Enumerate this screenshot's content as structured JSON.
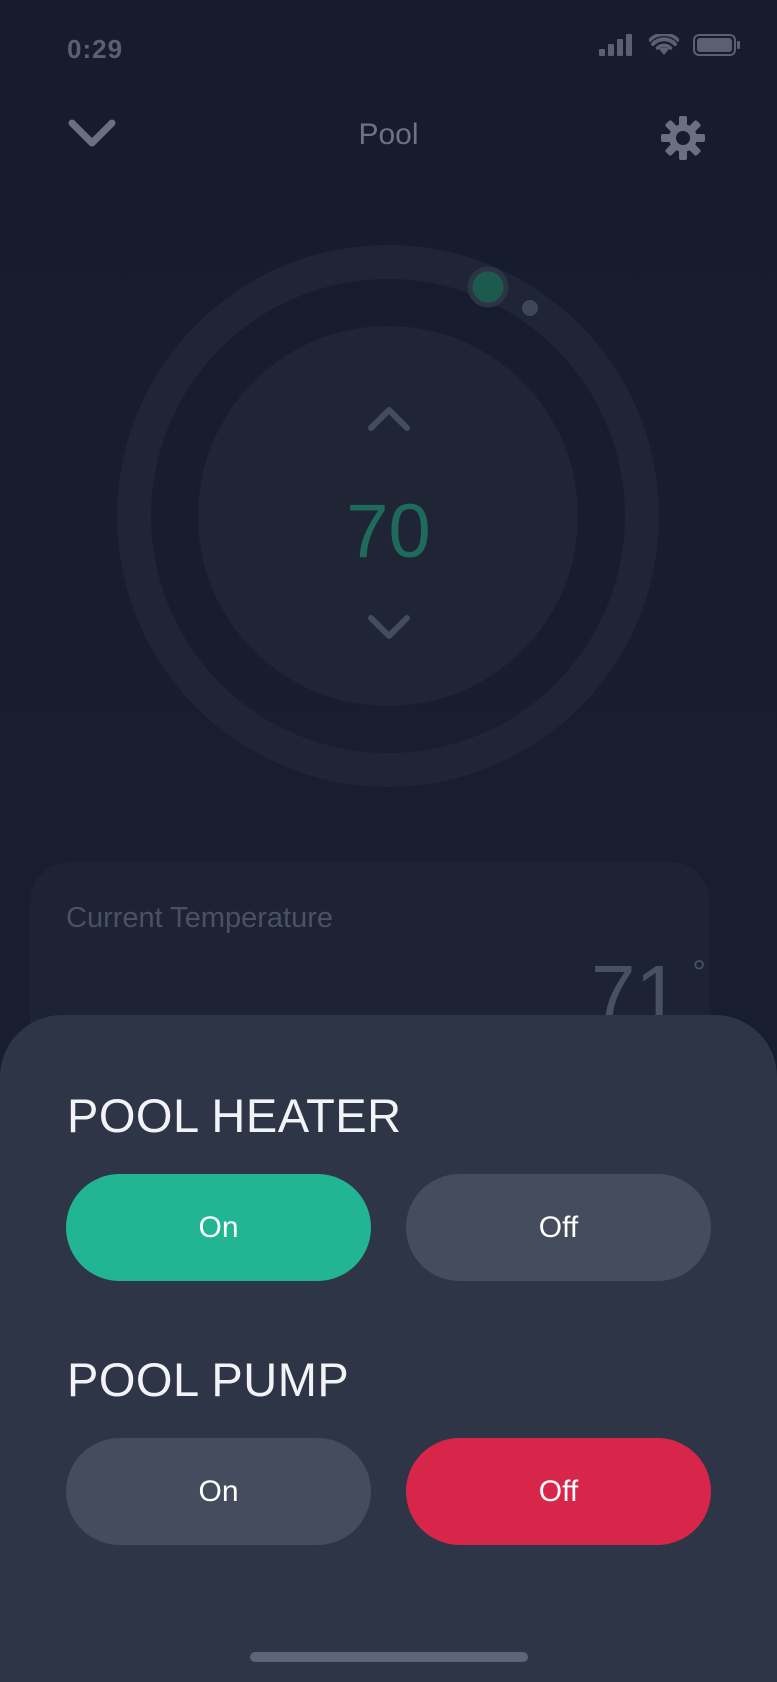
{
  "status_bar": {
    "time": "0:29",
    "icons": [
      "cellular-signal-icon",
      "wifi-icon",
      "battery-icon"
    ]
  },
  "header": {
    "title": "Pool",
    "back_icon": "chevron-down-icon",
    "settings_icon": "gear-icon"
  },
  "dial": {
    "value": "70",
    "up_icon": "chevron-up-icon",
    "down_icon": "chevron-down-icon"
  },
  "current_temperature": {
    "label": "Current Temperature",
    "value": "71",
    "unit": "°"
  },
  "pool_heater": {
    "title": "POOL HEATER",
    "on_label": "On",
    "off_label": "Off",
    "selected": "On"
  },
  "pool_pump": {
    "title": "POOL PUMP",
    "on_label": "On",
    "off_label": "Off",
    "selected": "Off"
  },
  "colors": {
    "accent_on": "#22b593",
    "accent_off": "#d8264b",
    "sheet_bg": "#2e3547",
    "background": "#161c2d"
  }
}
